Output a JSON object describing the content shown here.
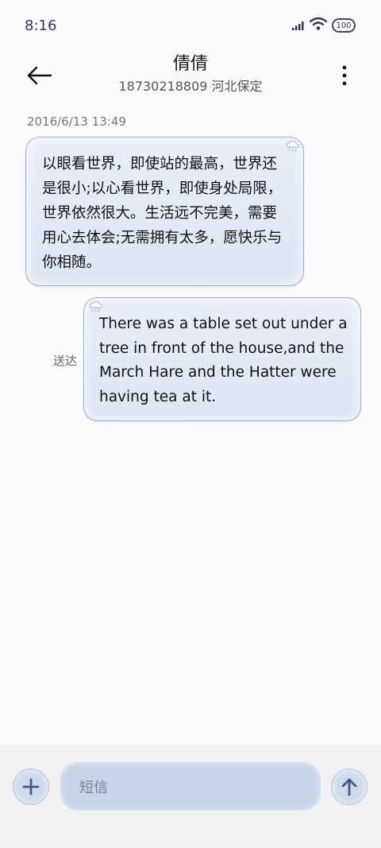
{
  "status_bar": {
    "time": "8:16",
    "battery_level": "100",
    "icons": [
      "signal-icon",
      "wifi-icon",
      "battery-icon"
    ]
  },
  "header": {
    "contact_name": "倩倩",
    "contact_sub": "18730218809 河北保定",
    "back_icon": "back-arrow-icon",
    "more_icon": "more-vertical-icon"
  },
  "conversation": {
    "timestamp": "2016/6/13 13:49",
    "messages": [
      {
        "direction": "incoming",
        "text": "以眼看世界，即使站的最高，世界还是很小;以心看世界，即使身处局限，世界依然很大。生活远不完美，需要用心去体会;无需拥有太多，愿快乐与你相随。"
      },
      {
        "direction": "outgoing",
        "text": "There was a table set out under a tree in front of the house,and the March Hare and the Hatter were having tea at it.",
        "status": "送达"
      }
    ]
  },
  "composer": {
    "placeholder": "短信",
    "add_icon": "plus-icon",
    "send_icon": "send-arrow-icon"
  },
  "colors": {
    "accent": "#3d5a8a",
    "bubble_bg": "#e3eaf6",
    "bubble_border": "#9fb2cf",
    "input_bg": "#c6d5e9"
  }
}
